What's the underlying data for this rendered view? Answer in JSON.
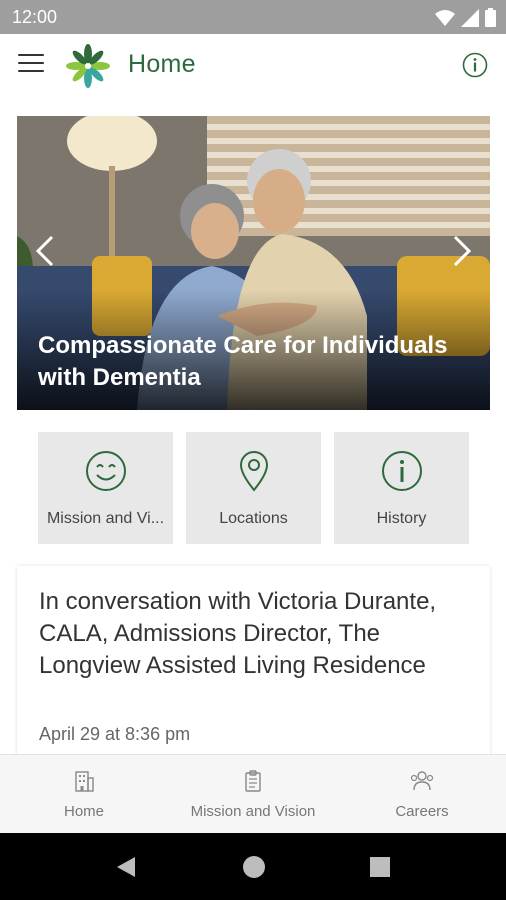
{
  "status_bar": {
    "time": "12:00",
    "icons": [
      "wifi-icon",
      "signal-icon",
      "battery-icon"
    ]
  },
  "app_bar": {
    "title": "Home",
    "menu_icon": "hamburger-menu-icon",
    "info_icon": "info-icon",
    "logo": "flower-logo"
  },
  "hero": {
    "caption": "Compassionate Care for Individuals with Dementia",
    "prev_icon": "chevron-left-icon",
    "next_icon": "chevron-right-icon"
  },
  "tiles": [
    {
      "label": "Mission and Vi...",
      "icon": "smiley-icon"
    },
    {
      "label": "Locations",
      "icon": "map-pin-icon"
    },
    {
      "label": "History",
      "icon": "info-circle-icon"
    }
  ],
  "article": {
    "title": "In conversation with Victoria Durante, CALA, Admissions Director, The Longview Assisted Living Residence",
    "date": "April 29 at 8:36 pm"
  },
  "bottom_nav": [
    {
      "label": "Home",
      "icon": "building-icon"
    },
    {
      "label": "Mission and Vision",
      "icon": "clipboard-icon"
    },
    {
      "label": "Careers",
      "icon": "people-icon"
    }
  ],
  "colors": {
    "brand_green": "#2e6a3c",
    "leaf_light": "#8cc63f",
    "leaf_teal": "#3aa6a0",
    "tile_bg": "#e8e8e8"
  }
}
